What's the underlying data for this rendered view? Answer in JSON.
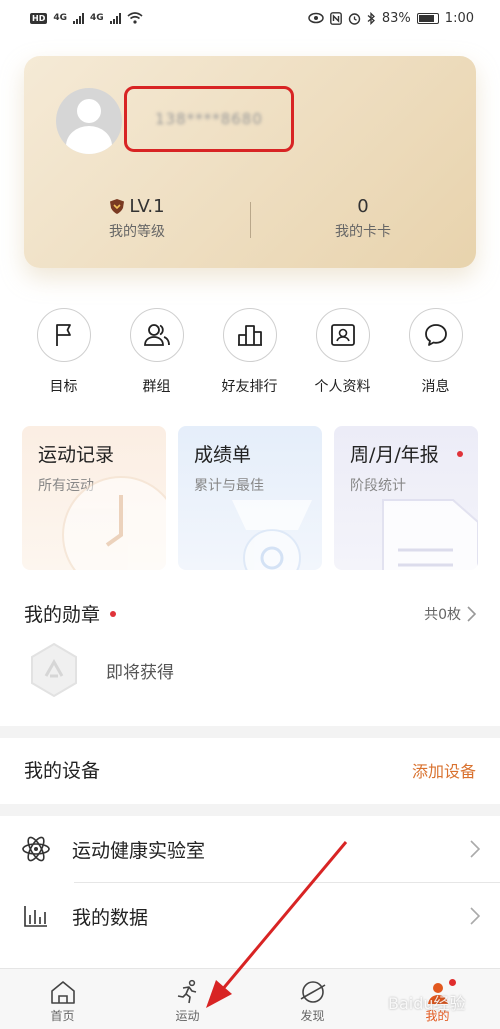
{
  "status_bar": {
    "left_badge": "HD",
    "signal_1": "4G",
    "signal_2": "4G",
    "right_icons": [
      "eye-icon",
      "nfc-icon",
      "alarm-icon",
      "bluetooth-icon"
    ],
    "battery": "83%",
    "time": "1:00"
  },
  "profile": {
    "phone_masked": "138****8680",
    "level": "LV.1",
    "level_label": "我的等级",
    "cards_count": "0",
    "cards_label": "我的卡卡"
  },
  "quick_actions": [
    {
      "label": "目标",
      "icon": "flag-icon"
    },
    {
      "label": "群组",
      "icon": "group-icon"
    },
    {
      "label": "好友排行",
      "icon": "ranking-icon"
    },
    {
      "label": "个人资料",
      "icon": "profile-card-icon"
    },
    {
      "label": "消息",
      "icon": "message-icon"
    }
  ],
  "tiles": [
    {
      "title": "运动记录",
      "subtitle": "所有运动"
    },
    {
      "title": "成绩单",
      "subtitle": "累计与最佳"
    },
    {
      "title": "周/月/年报",
      "subtitle": "阶段统计"
    }
  ],
  "medals": {
    "title": "我的勋章",
    "count": "共0枚",
    "pending": "即将获得"
  },
  "devices": {
    "title": "我的设备",
    "add": "添加设备"
  },
  "menu": [
    {
      "label": "运动健康实验室",
      "icon": "atom-icon"
    },
    {
      "label": "我的数据",
      "icon": "bar-chart-icon"
    }
  ],
  "tabbar": [
    {
      "label": "首页",
      "icon": "home-icon"
    },
    {
      "label": "运动",
      "icon": "running-icon"
    },
    {
      "label": "发现",
      "icon": "discover-icon"
    },
    {
      "label": "我的",
      "icon": "me-icon"
    }
  ],
  "watermark": "Baidu经验",
  "colors": {
    "accent": "#d9722f",
    "annotation": "#d82424",
    "badge": "#e0333a"
  }
}
